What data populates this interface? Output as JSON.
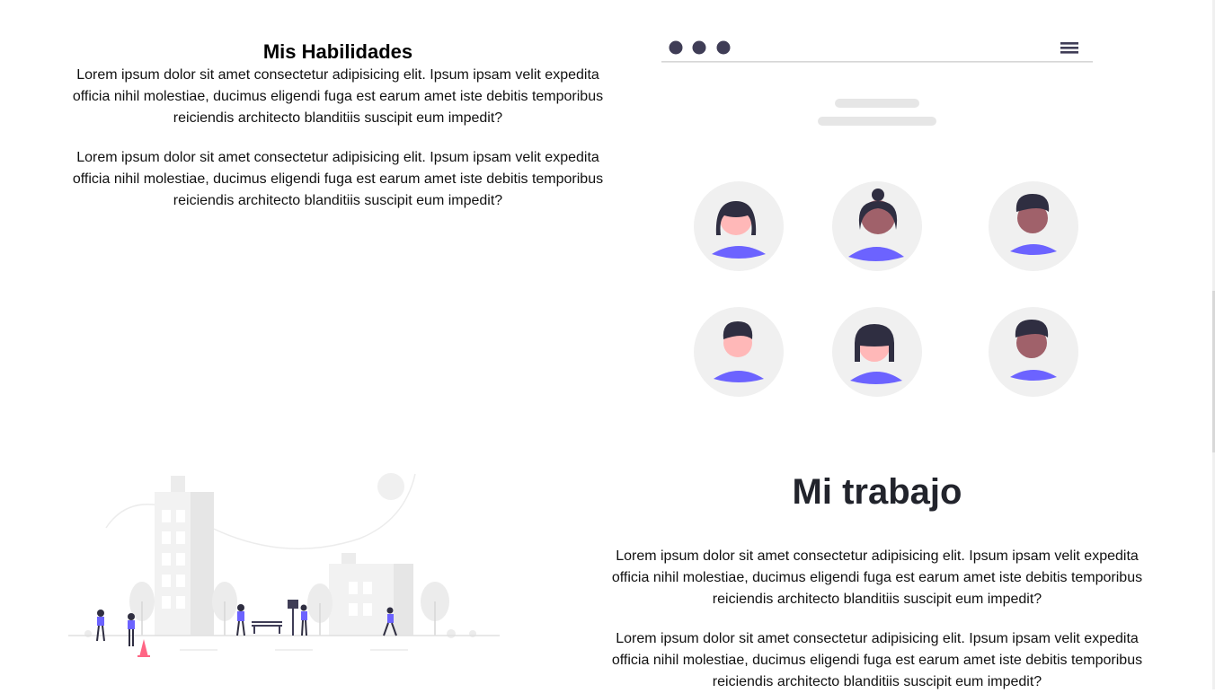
{
  "skills": {
    "title": "Mis Habilidades",
    "paragraphs": [
      "Lorem ipsum dolor sit amet consectetur adipisicing elit. Ipsum ipsam velit expedita officia nihil molestiae, ducimus eligendi fuga est earum amet iste debitis temporibus reiciendis architecto blanditiis suscipit eum impedit?",
      "Lorem ipsum dolor sit amet consectetur adipisicing elit. Ipsum ipsam velit expedita officia nihil molestiae, ducimus eligendi fuga est earum amet iste debitis temporibus reiciendis architecto blanditiis suscipit eum impedit?"
    ]
  },
  "work": {
    "title": "Mi trabajo",
    "paragraphs": [
      "Lorem ipsum dolor sit amet consectetur adipisicing elit. Ipsum ipsam velit expedita officia nihil molestiae, ducimus eligendi fuga est earum amet iste debitis temporibus reiciendis architecto blanditiis suscipit eum impedit?",
      "Lorem ipsum dolor sit amet consectetur adipisicing elit. Ipsum ipsam velit expedita officia nihil molestiae, ducimus eligendi fuga est earum amet iste debitis temporibus reiciendis architecto blanditiis suscipit eum impedit?"
    ]
  },
  "illustrations": {
    "team": {
      "icon": "team-avatars-illustration"
    },
    "city": {
      "icon": "city-park-illustration"
    }
  },
  "colors": {
    "accent": "#6c63ff",
    "dark": "#3f3d56",
    "light_gray": "#f0f0f0",
    "heading": "#22242c"
  }
}
